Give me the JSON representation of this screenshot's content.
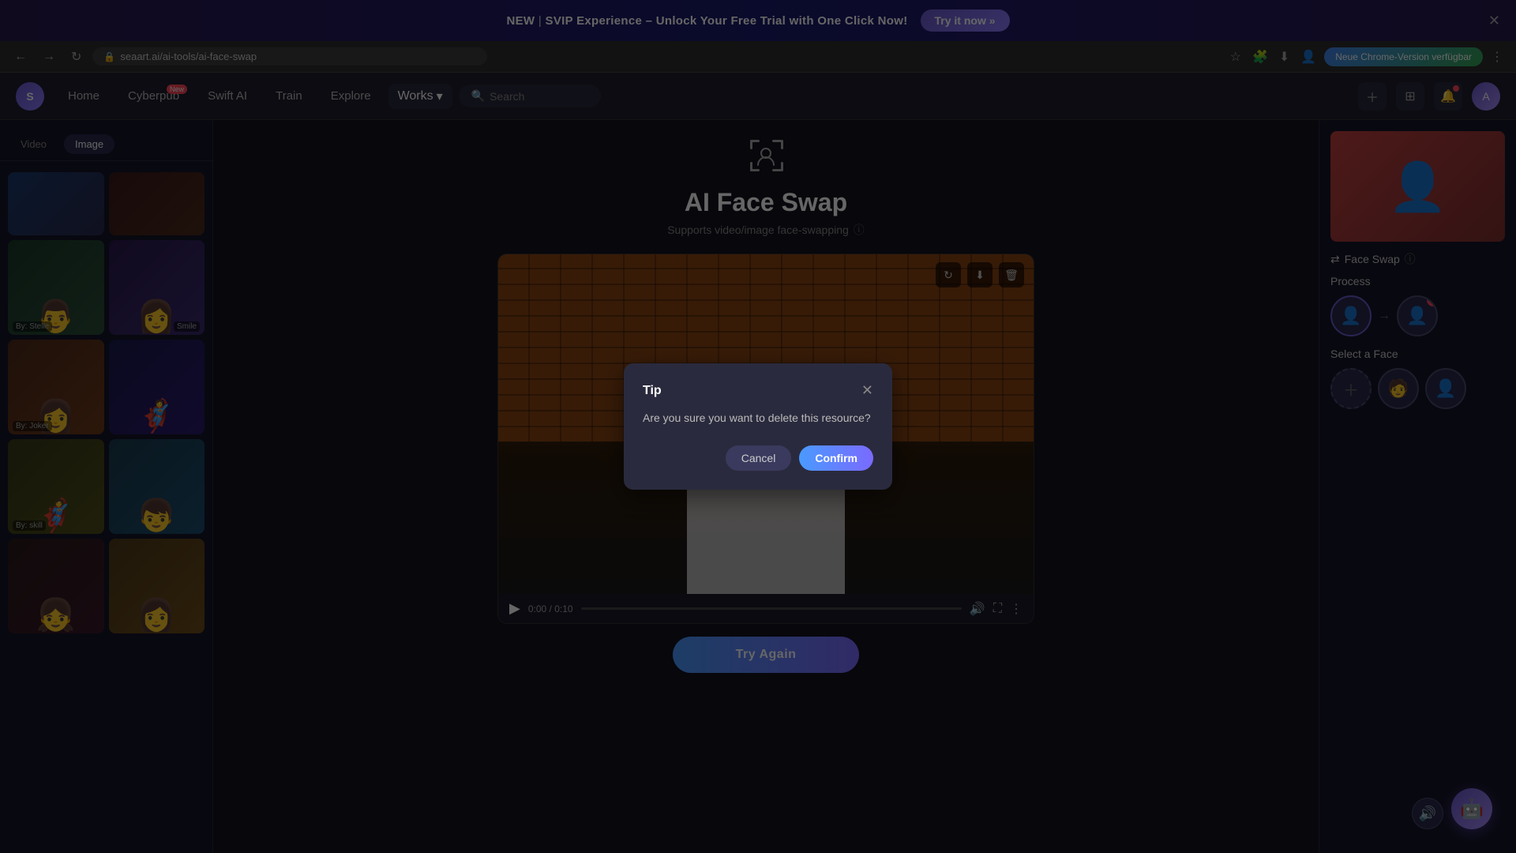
{
  "banner": {
    "text": "NEW | SVIP Experience – Unlock Your Free Trial with One Click Now!",
    "new_label": "NEW",
    "svip_text": "SVIP Experience – Unlock Your Free Trial with One Click Now!",
    "try_btn": "Try it now »"
  },
  "browser": {
    "url": "seaart.ai/ai-tools/ai-face-swap",
    "update_btn": "Neue Chrome-Version verfügbar"
  },
  "navbar": {
    "logo": "S",
    "home": "Home",
    "cyberpub": "Cyberpub",
    "cyberpub_badge": "New",
    "swift_ai": "Swift AI",
    "train": "Train",
    "explore": "Explore",
    "works": "Works",
    "search_placeholder": "Search"
  },
  "sidebar": {
    "tab_video": "Video",
    "tab_image": "Image",
    "thumbnails": [
      {
        "label": "",
        "type": "thumb1"
      },
      {
        "label": "",
        "type": "thumb2"
      },
      {
        "label": "By: Stelle",
        "type": "thumb3",
        "emoji": "👨"
      },
      {
        "label": "Smile",
        "type": "thumb4",
        "emoji": "👩"
      },
      {
        "label": "By: Joker",
        "type": "thumb5",
        "emoji": "👩"
      },
      {
        "label": "",
        "type": "thumb6",
        "emoji": "🦸"
      },
      {
        "label": "By: skill",
        "type": "thumb7",
        "emoji": "🦸"
      },
      {
        "label": "",
        "type": "thumb8",
        "emoji": "👦"
      },
      {
        "label": "",
        "type": "thumb9",
        "emoji": "👧"
      },
      {
        "label": "",
        "type": "thumb10",
        "emoji": "👩"
      }
    ]
  },
  "main": {
    "page_icon": "🔍",
    "page_title": "AI Face Swap",
    "page_subtitle": "Supports video/image face-swapping",
    "video": {
      "time_current": "0:00",
      "time_total": "0:10",
      "progress": 0
    },
    "try_again_btn": "Try Again"
  },
  "right_panel": {
    "face_swap_title": "Face Swap",
    "process_title": "Process",
    "select_face_title": "Select a Face"
  },
  "modal": {
    "title": "Tip",
    "message": "Are you sure you want to delete this resource?",
    "cancel_btn": "Cancel",
    "confirm_btn": "Confirm"
  },
  "colors": {
    "accent": "#6a5acd",
    "accent2": "#4a9aff",
    "danger": "#ff4757",
    "bg_dark": "#12121f",
    "bg_mid": "#1e1e2e",
    "bg_light": "#2a2a3e"
  }
}
